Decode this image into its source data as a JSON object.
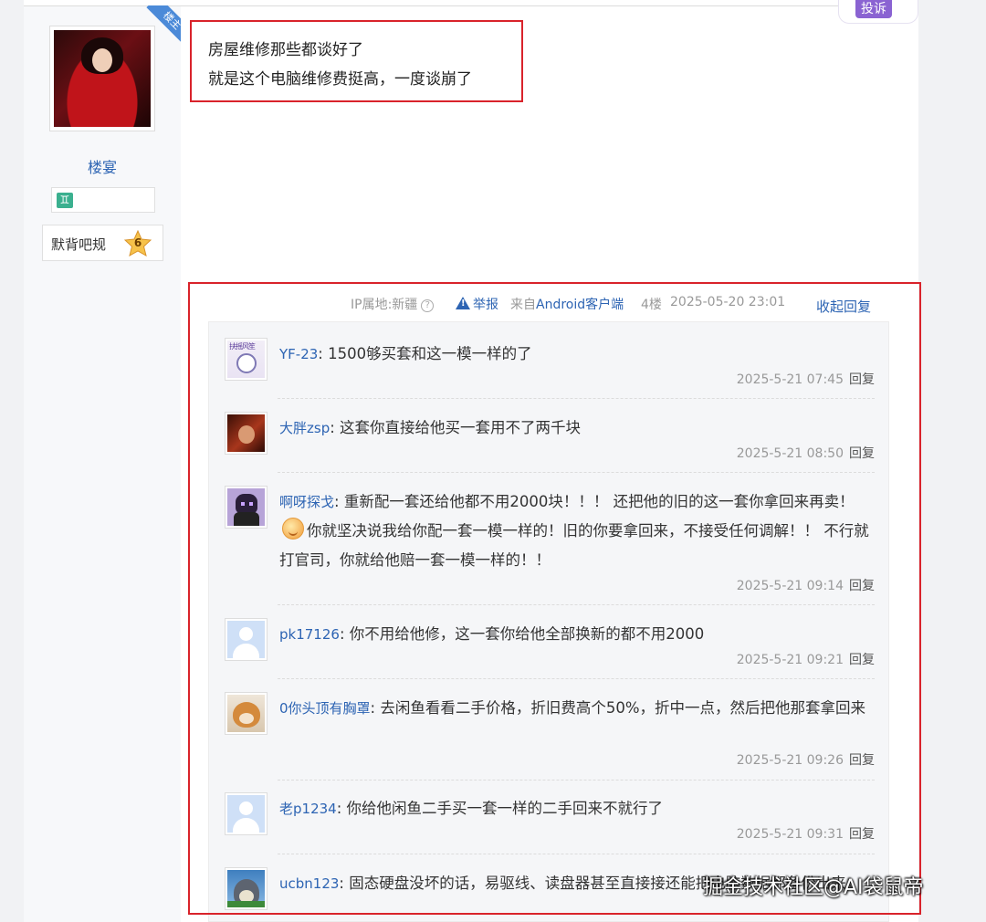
{
  "author": {
    "name": "楼宴",
    "ribbon": "楼主",
    "level_icon": "♊",
    "badge_label": "默背吧规",
    "badge_level": "6"
  },
  "top_button": "投诉",
  "post": {
    "lines": [
      "房屋维修那些都谈好了",
      "就是这个电脑维修费挺高，一度谈崩了"
    ]
  },
  "meta": {
    "ip": "IP属地:新疆",
    "report": "举报",
    "client_prefix": "来自",
    "client_name": "Android客户端",
    "floor": "4楼",
    "date": "2025-05-20 23:01",
    "collapse": "收起回复"
  },
  "comments": [
    {
      "user": "YF-23",
      "text": "1500够买套和这一模一样的了",
      "time": "2025-5-21 07:45",
      "reply": "回复",
      "avatar_text": "扶摇风笙"
    },
    {
      "user": "大胖zsp",
      "text": "这套你直接给他买一套用不了两千块",
      "time": "2025-5-21 08:50",
      "reply": "回复"
    },
    {
      "user": "啊呀探戈",
      "text_a": "重新配一套还给他都不用2000块！！！ 还把他的旧的这一套你拿回来再卖！",
      "text_b": "你就坚决说我给你配一套一模一样的！旧的你要拿回来，不接受任何调解！！ 不行就打官司，你就给他赔一套一模一样的！！",
      "time": "2025-5-21 09:14",
      "reply": "回复"
    },
    {
      "user": "pk17126",
      "text": "你不用给他修，这一套你给他全部换新的都不用2000",
      "time": "2025-5-21 09:21",
      "reply": "回复"
    },
    {
      "user": "0你头顶有胸罩",
      "text": "去闲鱼看看二手价格，折旧费高个50%，折中一点，然后把他那套拿回来",
      "time": "2025-5-21 09:26",
      "reply": "回复"
    },
    {
      "user": "老p1234",
      "text": "你给他闲鱼二手买一套一样的二手回来不就行了",
      "time": "2025-5-21 09:31",
      "reply": "回复"
    },
    {
      "user": "ucbn123",
      "text": "固态硬盘没坏的话，易驱线、读盘器甚至直接接还能把电脑数据都备份出来。"
    }
  ],
  "watermark": "掘金技术社区@AI袋鼠帝",
  "colors": {
    "accent": "#2d64b3",
    "highlight": "#d9232b",
    "meta": "#999999"
  }
}
